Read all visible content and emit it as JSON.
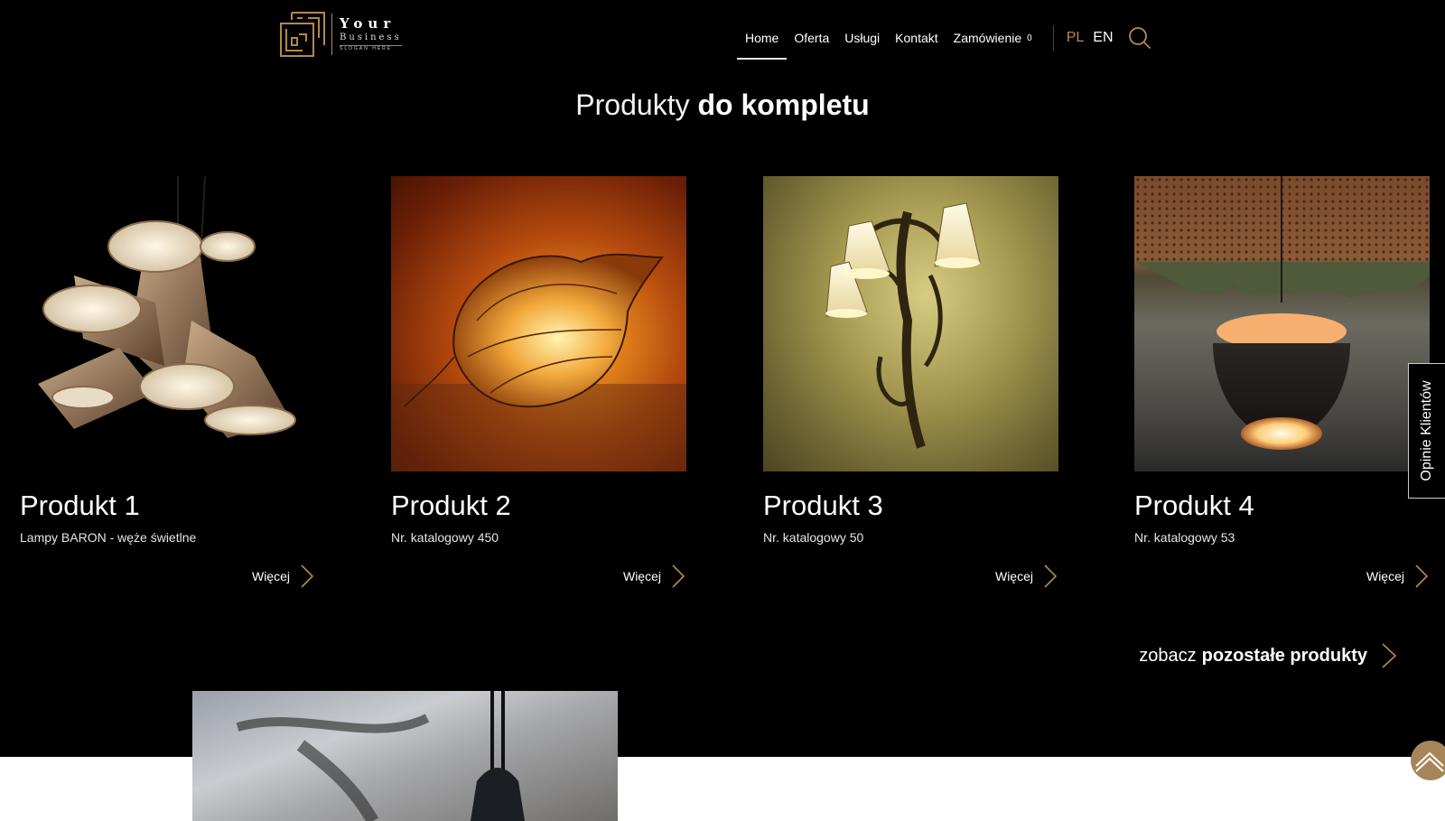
{
  "brand": {
    "name": "Your",
    "sub": "Business",
    "slogan": "SLOGAN HERE",
    "accent_color": "#b08a4a"
  },
  "nav": {
    "items": [
      "Home",
      "Oferta",
      "Usługi",
      "Kontakt",
      "Zamówienie"
    ],
    "cart_count": "0",
    "active": "Home",
    "languages": [
      "PL",
      "EN"
    ],
    "active_language": "PL"
  },
  "section": {
    "title_light": "Produkty",
    "title_bold": "do kompletu"
  },
  "products": [
    {
      "name": "Produkt 1",
      "desc": "Lampy BARON - węże świetlne",
      "more": "Więcej"
    },
    {
      "name": "Produkt 2",
      "desc": "Nr. katalogowy 450",
      "more": "Więcej"
    },
    {
      "name": "Produkt 3",
      "desc": "Nr. katalogowy 50",
      "more": "Więcej"
    },
    {
      "name": "Produkt 4",
      "desc": "Nr. katalogowy 53",
      "more": "Więcej"
    }
  ],
  "see_all": {
    "light": "zobacz",
    "bold": "pozostałe produkty"
  },
  "side_tab": "Opinie Klientów",
  "icons": {
    "search": "search-icon",
    "arrow": "chevron-right-icon",
    "scroll_top": "chevron-up-icon"
  }
}
